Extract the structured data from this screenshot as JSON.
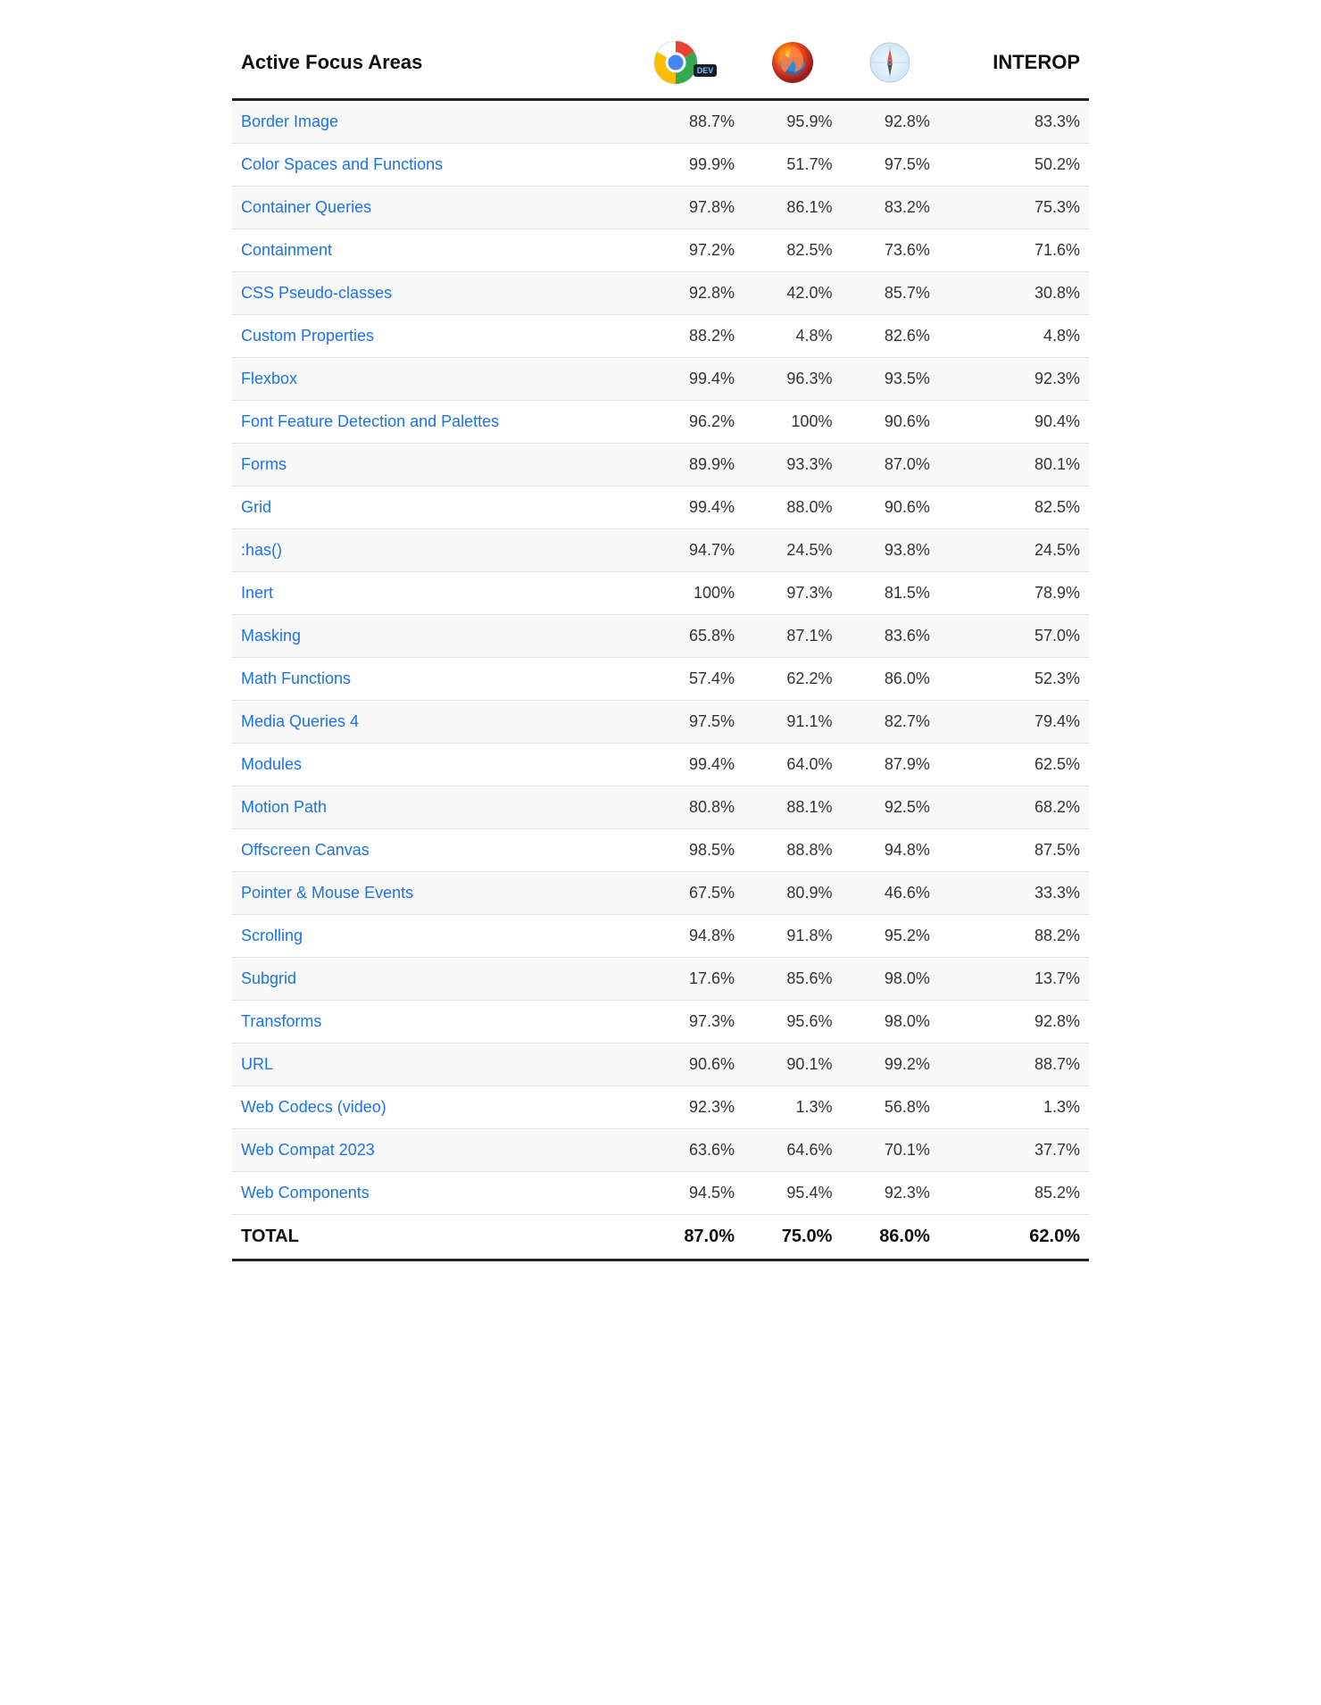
{
  "header": {
    "title": "Active Focus Areas",
    "interop_label": "INTEROP",
    "col1_browser": "Chrome Dev",
    "col2_browser": "Firefox",
    "col3_browser": "Safari"
  },
  "rows": [
    {
      "name": "Border Image",
      "col1": "88.7%",
      "col2": "95.9%",
      "col3": "92.8%",
      "interop": "83.3%"
    },
    {
      "name": "Color Spaces and Functions",
      "col1": "99.9%",
      "col2": "51.7%",
      "col3": "97.5%",
      "interop": "50.2%"
    },
    {
      "name": "Container Queries",
      "col1": "97.8%",
      "col2": "86.1%",
      "col3": "83.2%",
      "interop": "75.3%"
    },
    {
      "name": "Containment",
      "col1": "97.2%",
      "col2": "82.5%",
      "col3": "73.6%",
      "interop": "71.6%"
    },
    {
      "name": "CSS Pseudo-classes",
      "col1": "92.8%",
      "col2": "42.0%",
      "col3": "85.7%",
      "interop": "30.8%"
    },
    {
      "name": "Custom Properties",
      "col1": "88.2%",
      "col2": "4.8%",
      "col3": "82.6%",
      "interop": "4.8%"
    },
    {
      "name": "Flexbox",
      "col1": "99.4%",
      "col2": "96.3%",
      "col3": "93.5%",
      "interop": "92.3%"
    },
    {
      "name": "Font Feature Detection and Palettes",
      "col1": "96.2%",
      "col2": "100%",
      "col3": "90.6%",
      "interop": "90.4%"
    },
    {
      "name": "Forms",
      "col1": "89.9%",
      "col2": "93.3%",
      "col3": "87.0%",
      "interop": "80.1%"
    },
    {
      "name": "Grid",
      "col1": "99.4%",
      "col2": "88.0%",
      "col3": "90.6%",
      "interop": "82.5%"
    },
    {
      "name": ":has()",
      "col1": "94.7%",
      "col2": "24.5%",
      "col3": "93.8%",
      "interop": "24.5%"
    },
    {
      "name": "Inert",
      "col1": "100%",
      "col2": "97.3%",
      "col3": "81.5%",
      "interop": "78.9%"
    },
    {
      "name": "Masking",
      "col1": "65.8%",
      "col2": "87.1%",
      "col3": "83.6%",
      "interop": "57.0%"
    },
    {
      "name": "Math Functions",
      "col1": "57.4%",
      "col2": "62.2%",
      "col3": "86.0%",
      "interop": "52.3%"
    },
    {
      "name": "Media Queries 4",
      "col1": "97.5%",
      "col2": "91.1%",
      "col3": "82.7%",
      "interop": "79.4%"
    },
    {
      "name": "Modules",
      "col1": "99.4%",
      "col2": "64.0%",
      "col3": "87.9%",
      "interop": "62.5%"
    },
    {
      "name": "Motion Path",
      "col1": "80.8%",
      "col2": "88.1%",
      "col3": "92.5%",
      "interop": "68.2%"
    },
    {
      "name": "Offscreen Canvas",
      "col1": "98.5%",
      "col2": "88.8%",
      "col3": "94.8%",
      "interop": "87.5%"
    },
    {
      "name": "Pointer & Mouse Events",
      "col1": "67.5%",
      "col2": "80.9%",
      "col3": "46.6%",
      "interop": "33.3%"
    },
    {
      "name": "Scrolling",
      "col1": "94.8%",
      "col2": "91.8%",
      "col3": "95.2%",
      "interop": "88.2%"
    },
    {
      "name": "Subgrid",
      "col1": "17.6%",
      "col2": "85.6%",
      "col3": "98.0%",
      "interop": "13.7%"
    },
    {
      "name": "Transforms",
      "col1": "97.3%",
      "col2": "95.6%",
      "col3": "98.0%",
      "interop": "92.8%"
    },
    {
      "name": "URL",
      "col1": "90.6%",
      "col2": "90.1%",
      "col3": "99.2%",
      "interop": "88.7%"
    },
    {
      "name": "Web Codecs (video)",
      "col1": "92.3%",
      "col2": "1.3%",
      "col3": "56.8%",
      "interop": "1.3%"
    },
    {
      "name": "Web Compat 2023",
      "col1": "63.6%",
      "col2": "64.6%",
      "col3": "70.1%",
      "interop": "37.7%"
    },
    {
      "name": "Web Components",
      "col1": "94.5%",
      "col2": "95.4%",
      "col3": "92.3%",
      "interop": "85.2%"
    }
  ],
  "total": {
    "label": "TOTAL",
    "col1": "87.0%",
    "col2": "75.0%",
    "col3": "86.0%",
    "interop": "62.0%"
  }
}
